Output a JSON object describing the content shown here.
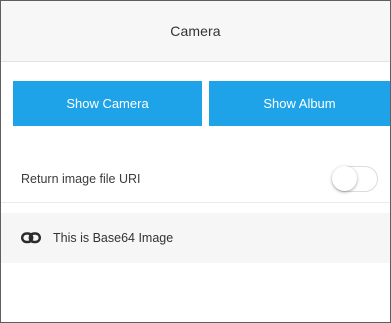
{
  "header": {
    "title": "Camera"
  },
  "actions": {
    "show_camera_label": "Show Camera",
    "show_album_label": "Show Album"
  },
  "settings": {
    "return_uri_label": "Return image file URI",
    "return_uri_enabled": false
  },
  "result": {
    "icon": "link-icon",
    "text": "This is Base64 Image"
  },
  "colors": {
    "accent": "#1ea3e8",
    "nav_background": "#f7f7f7",
    "result_background": "#f6f6f6"
  }
}
